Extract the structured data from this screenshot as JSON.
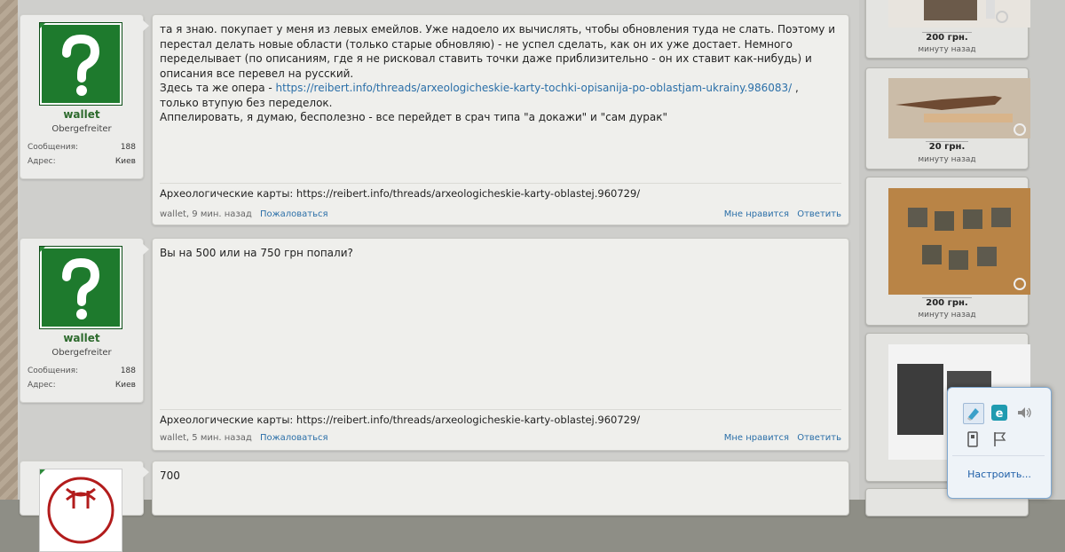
{
  "posts": [
    {
      "username": "wallet",
      "user_title": "Obergefreiter",
      "messages_label": "Сообщения:",
      "messages_count": "188",
      "address_label": "Адрес:",
      "address_value": "Киев",
      "body_line1": "та я знаю. покупает у меня из левых емейлов. Уже надоело их вычислять, чтобы обновления туда не слать. Поэтому и",
      "body_line2": "перестал делать новые области (только старые обновляю) - не успел сделать, как он их уже достает. Немного",
      "body_line3": "переделывает (по описаниям, где я не рисковал ставить точки даже приблизительно - он их ставит как-нибудь) и",
      "body_line4": "описания все перевел на русский.",
      "body_line5_prefix": "Здесь та же опера - ",
      "body_line5_link": "https://reibert.info/threads/arxeologicheskie-karty-tochki-opisanija-po-oblastjam-ukrainy.986083/",
      "body_line5_suffix": " ,",
      "body_line6": "только втупую без переделок.",
      "body_line7": "Аппелировать, я думаю, бесполезно - все перейдет в срач типа \"а докажи\" и \"сам дурак\"",
      "signature": "Археологические карты: https://reibert.info/threads/arxeologicheskie-karty-oblastej.960729/",
      "meta": "wallet, 9 мин. назад",
      "report": "Пожаловаться",
      "like": "Мне нравится",
      "reply": "Ответить"
    },
    {
      "username": "wallet",
      "user_title": "Obergefreiter",
      "messages_label": "Сообщения:",
      "messages_count": "188",
      "address_label": "Адрес:",
      "address_value": "Киев",
      "body_line1": "Вы на 500 или на 750 грн попали?",
      "signature": "Археологические карты: https://reibert.info/threads/arxeologicheskie-karty-oblastej.960729/",
      "meta": "wallet, 5 мин. назад",
      "report": "Пожаловаться",
      "like": "Мне нравится",
      "reply": "Ответить"
    },
    {
      "body_line1": "700"
    }
  ],
  "sidebar_ads": [
    {
      "price": "200 грн.",
      "time": "минуту назад"
    },
    {
      "price": "20 грн.",
      "time": "минуту назад"
    },
    {
      "price": "200 грн.",
      "time": "минуту назад"
    }
  ],
  "tray_popup": {
    "customize": "Настроить..."
  },
  "colors": {
    "avatar_green": "#1e7a2d",
    "link_blue": "#2b6fa8",
    "username_green": "#2d6a2d"
  }
}
